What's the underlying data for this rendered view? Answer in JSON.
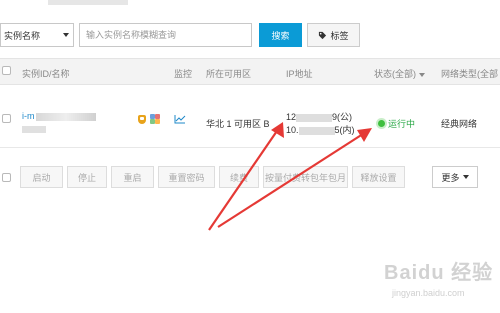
{
  "filter": {
    "selected": "实例名称"
  },
  "search": {
    "placeholder": "输入实例名称模糊查询",
    "value": ""
  },
  "buttons": {
    "search": "搜索",
    "tag": "标签"
  },
  "columns": [
    "实例ID/名称",
    "监控",
    "所在可用区",
    "IP地址",
    "状态(全部)",
    "网络类型(全部"
  ],
  "instance": {
    "id_prefix": "i-m",
    "zone": "华北 1 可用区 B",
    "ip_public_prefix": "12",
    "ip_public_suffix": "9(公)",
    "ip_private_prefix": "10.",
    "ip_private_suffix": "5(内)",
    "status": "运行中",
    "network": "经典网络"
  },
  "actions": [
    "启动",
    "停止",
    "重启",
    "重置密码",
    "续费",
    "按量付费转包年包月",
    "释放设置",
    "更多"
  ],
  "watermark": {
    "text": "Baidu 经验",
    "sub": "jingyan.baidu.com"
  },
  "colors": {
    "accent": "#0b9bd6",
    "running": "#28a745",
    "arrow": "#e53935",
    "link": "#1e88c9"
  }
}
